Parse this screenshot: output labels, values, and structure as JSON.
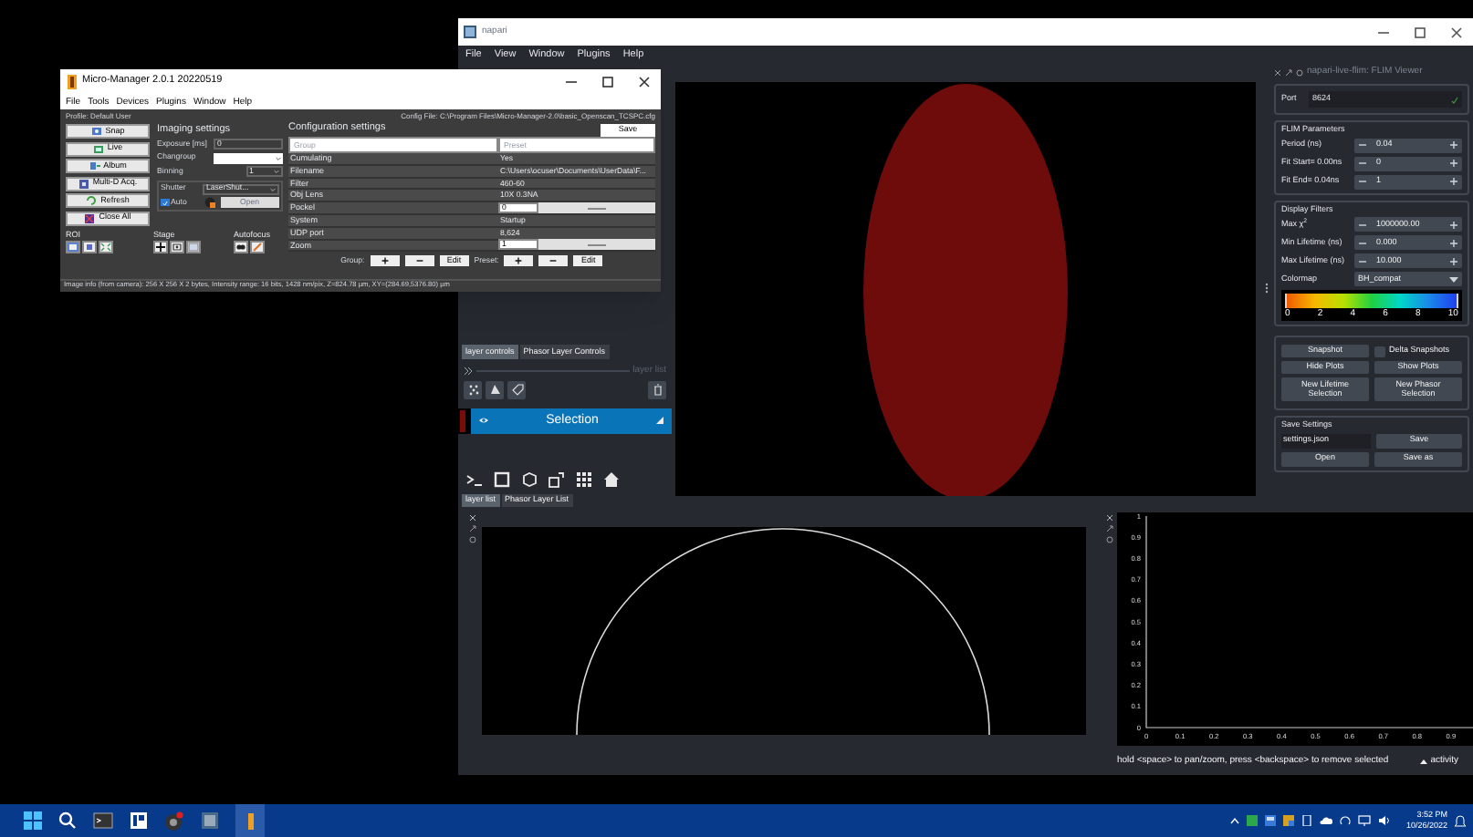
{
  "micro_manager": {
    "title": "Micro-Manager 2.0.1 20220519",
    "menu": [
      "File",
      "Tools",
      "Devices",
      "Plugins",
      "Window",
      "Help"
    ],
    "profile": "Profile: Default User",
    "config_file": "Config File: C:\\Program Files\\Micro-Manager-2.0\\basic_Openscan_TCSPC.cfg",
    "buttons": [
      {
        "label": "Snap",
        "kind": "snap"
      },
      {
        "label": "Live",
        "kind": "live"
      },
      {
        "label": "Album",
        "kind": "album"
      },
      {
        "label": "Multi-D Acq.",
        "kind": "multid"
      },
      {
        "label": "Refresh",
        "kind": "refresh"
      },
      {
        "label": "Close All",
        "kind": "closeall"
      }
    ],
    "imaging": {
      "title": "Imaging settings",
      "exposure_label": "Exposure [ms]",
      "exposure": "0",
      "changroup_label": "Changroup",
      "binning_label": "Binning",
      "binning": "1",
      "shutter_label": "Shutter",
      "shutter": "LaserShut...",
      "auto_label": "Auto",
      "auto": true,
      "open": "Open"
    },
    "roi_label": "ROI",
    "stage_label": "Stage",
    "autofocus_label": "Autofocus",
    "config": {
      "title": "Configuration settings",
      "save": "Save",
      "group_placeholder": "Group",
      "preset_placeholder": "Preset",
      "rows": [
        {
          "group": "Cumulating",
          "value": "Yes",
          "kind": "text"
        },
        {
          "group": "Filename",
          "value": "C:\\Users\\ocuser\\Documents\\UserData\\F...",
          "kind": "text"
        },
        {
          "group": "Filter",
          "value": "460-60",
          "kind": "text"
        },
        {
          "group": "Obj Lens",
          "value": "10X 0.3NA",
          "kind": "text"
        },
        {
          "group": "Pockel",
          "value": "0",
          "kind": "slider",
          "level": 0.5
        },
        {
          "group": "System",
          "value": "Startup",
          "kind": "text"
        },
        {
          "group": "UDP port",
          "value": "8,624",
          "kind": "text"
        },
        {
          "group": "Zoom",
          "value": "1",
          "kind": "slider",
          "level": 0.5
        }
      ],
      "group_label": "Group:",
      "group_edit": "Edit",
      "preset_label": "Preset:",
      "preset_edit": "Edit"
    },
    "status": "Image info (from camera): 256 X 256 X 2 bytes, Intensity range: 16 bits, 1428 nm/pix, Z=824.78 µm, XY=(284.69,5376.80) µm"
  },
  "napari": {
    "title": "napari",
    "menu": [
      "File",
      "View",
      "Window",
      "Plugins",
      "Help"
    ],
    "control_tabs": [
      {
        "label": "layer controls",
        "selected": true
      },
      {
        "label": "Phasor Layer Controls",
        "selected": false
      }
    ],
    "layer_list_title": "layer list",
    "layers": [
      {
        "name": "Selection",
        "selected": true,
        "visible": true
      }
    ],
    "list_tabs": [
      {
        "label": "layer list",
        "selected": true
      },
      {
        "label": "Phasor Layer List",
        "selected": false
      }
    ],
    "flim": {
      "title": "napari-live-flim: FLIM Viewer",
      "port_label": "Port",
      "port": "8624",
      "params_title": "FLIM Parameters",
      "params": [
        {
          "label": "Period (ns)",
          "value": "0.04"
        },
        {
          "label": "Fit Start= 0.00ns",
          "value": "0"
        },
        {
          "label": "Fit End= 0.04ns",
          "value": "1"
        }
      ],
      "filters_title": "Display Filters",
      "filters": [
        {
          "label": "Max χ$^{2}$",
          "value": "1000000.00"
        },
        {
          "label": "Min Lifetime (ns)",
          "value": "0.000"
        },
        {
          "label": "Max Lifetime (ns)",
          "value": "10.000"
        }
      ],
      "colormap_label": "Colormap",
      "colormap": "BH_compat",
      "colorbar_ticks": [
        "0",
        "2",
        "4",
        "6",
        "8",
        "10"
      ],
      "snapshot": "Snapshot",
      "delta_label": "Delta Snapshots",
      "delta": false,
      "hide_plots": "Hide Plots",
      "show_plots": "Show Plots",
      "new_lifetime": "New Lifetime Selection",
      "new_phasor": "New Phasor Selection",
      "save_title": "Save Settings",
      "settings_file": "settings.json",
      "save": "Save",
      "open": "Open",
      "save_as": "Save as"
    },
    "phasor_plot": {
      "y_ticks": [
        "1",
        "0.9",
        "0.8",
        "0.7",
        "0.6",
        "0.5",
        "0.4",
        "0.3",
        "0.2",
        "0.1",
        "0"
      ],
      "x_ticks": [
        "0",
        "0.1",
        "0.2",
        "0.3",
        "0.4",
        "0.5",
        "0.6",
        "0.7",
        "0.8",
        "0.9"
      ]
    },
    "status": "hold <space> to pan/zoom, press <backspace> to remove selected",
    "activity": "activity"
  },
  "taskbar": {
    "time": "3:52 PM",
    "date": "10/26/2022"
  }
}
